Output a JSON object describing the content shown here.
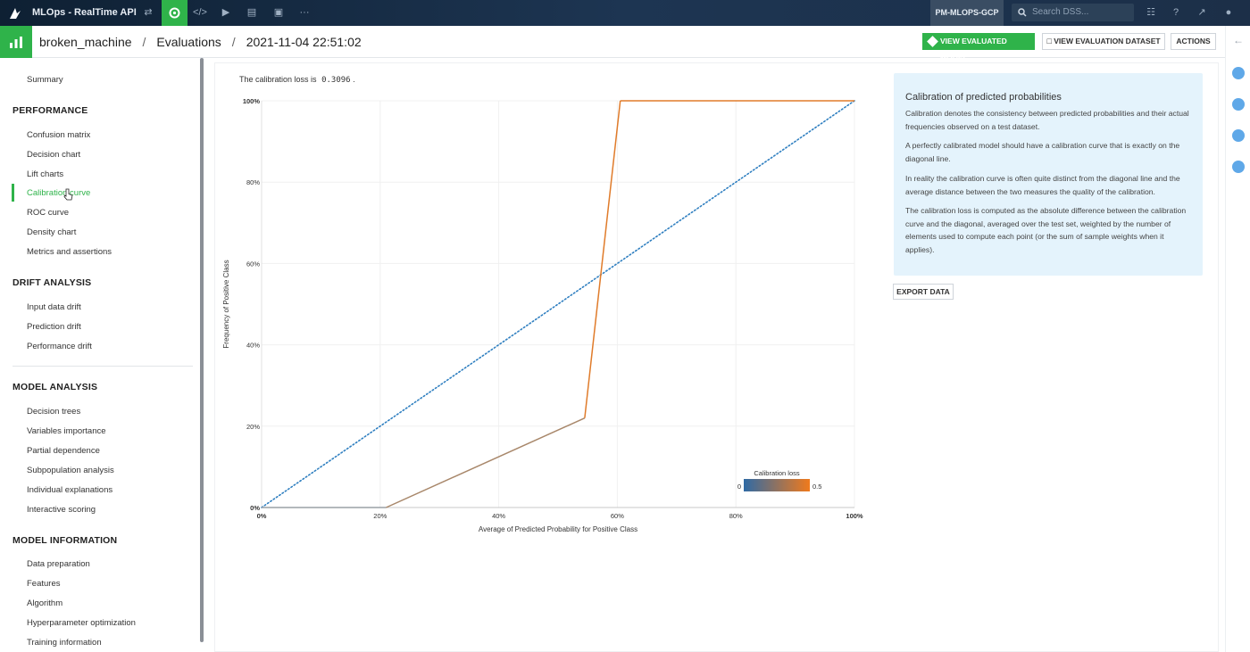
{
  "app": {
    "title": "MLOps - RealTime API",
    "project": "PM-MLOPS-GCP",
    "search_placeholder": "Search DSS..."
  },
  "breadcrumb": {
    "model": "broken_machine",
    "section": "Evaluations",
    "evaluation": "2021-11-04 22:51:02"
  },
  "header_buttons": {
    "view_model": "VIEW EVALUATED MODEL",
    "view_dataset": "VIEW EVALUATION DATASET",
    "actions": "ACTIONS"
  },
  "sidebar": {
    "summary": "Summary",
    "sections": [
      {
        "title": "PERFORMANCE",
        "items": [
          "Confusion matrix",
          "Decision chart",
          "Lift charts",
          "Calibration curve",
          "ROC curve",
          "Density chart",
          "Metrics and assertions"
        ]
      },
      {
        "title": "DRIFT ANALYSIS",
        "items": [
          "Input data drift",
          "Prediction drift",
          "Performance drift"
        ]
      },
      {
        "title": "MODEL ANALYSIS",
        "items": [
          "Decision trees",
          "Variables importance",
          "Partial dependence",
          "Subpopulation analysis",
          "Individual explanations",
          "Interactive scoring"
        ]
      },
      {
        "title": "MODEL INFORMATION",
        "items": [
          "Data preparation",
          "Features",
          "Algorithm",
          "Hyperparameter optimization",
          "Training information"
        ]
      }
    ],
    "active_item": "Calibration curve"
  },
  "calibration": {
    "loss_prefix": "The calibration loss is",
    "loss_value": "0.3096",
    "loss_suffix": "."
  },
  "info": {
    "title": "Calibration of predicted probabilities",
    "p1": "Calibration denotes the consistency between predicted probabilities and their actual frequencies observed on a test dataset.",
    "p2": "A perfectly calibrated model should have a calibration curve that is exactly on the diagonal line.",
    "p3": "In reality the calibration curve is often quite distinct from the diagonal line and the average distance between the two measures the quality of the calibration.",
    "p4": "The calibration loss is computed as the absolute difference between the calibration curve and the diagonal, averaged over the test set, weighted by the number of elements used to compute each point (or the sum of sample weights when it applies).",
    "export_button": "EXPORT DATA"
  },
  "chart_data": {
    "type": "line",
    "xlabel": "Average of Predicted Probability for Positive Class",
    "ylabel": "Frequency of Positive Class",
    "xlim": [
      0,
      1
    ],
    "ylim": [
      0,
      1
    ],
    "xticks": [
      "0%",
      "20%",
      "40%",
      "60%",
      "80%",
      "100%"
    ],
    "yticks": [
      "0%",
      "20%",
      "40%",
      "60%",
      "80%",
      "100%"
    ],
    "series": [
      {
        "x": [
          0,
          0.21,
          0.545,
          0.605,
          1.0
        ],
        "y": [
          0,
          0,
          0.22,
          1.0,
          1.0
        ]
      },
      {
        "x": [
          0,
          1
        ],
        "y": [
          0,
          1
        ]
      }
    ],
    "legend": {
      "title": "Calibration loss",
      "min_label": "0",
      "max_label": "0.5"
    },
    "colors": {
      "curve": "#e07b2a",
      "diagonal": "#2f7fc0",
      "gradient_start": "#2f6aa5",
      "gradient_end": "#f07a1c"
    }
  }
}
